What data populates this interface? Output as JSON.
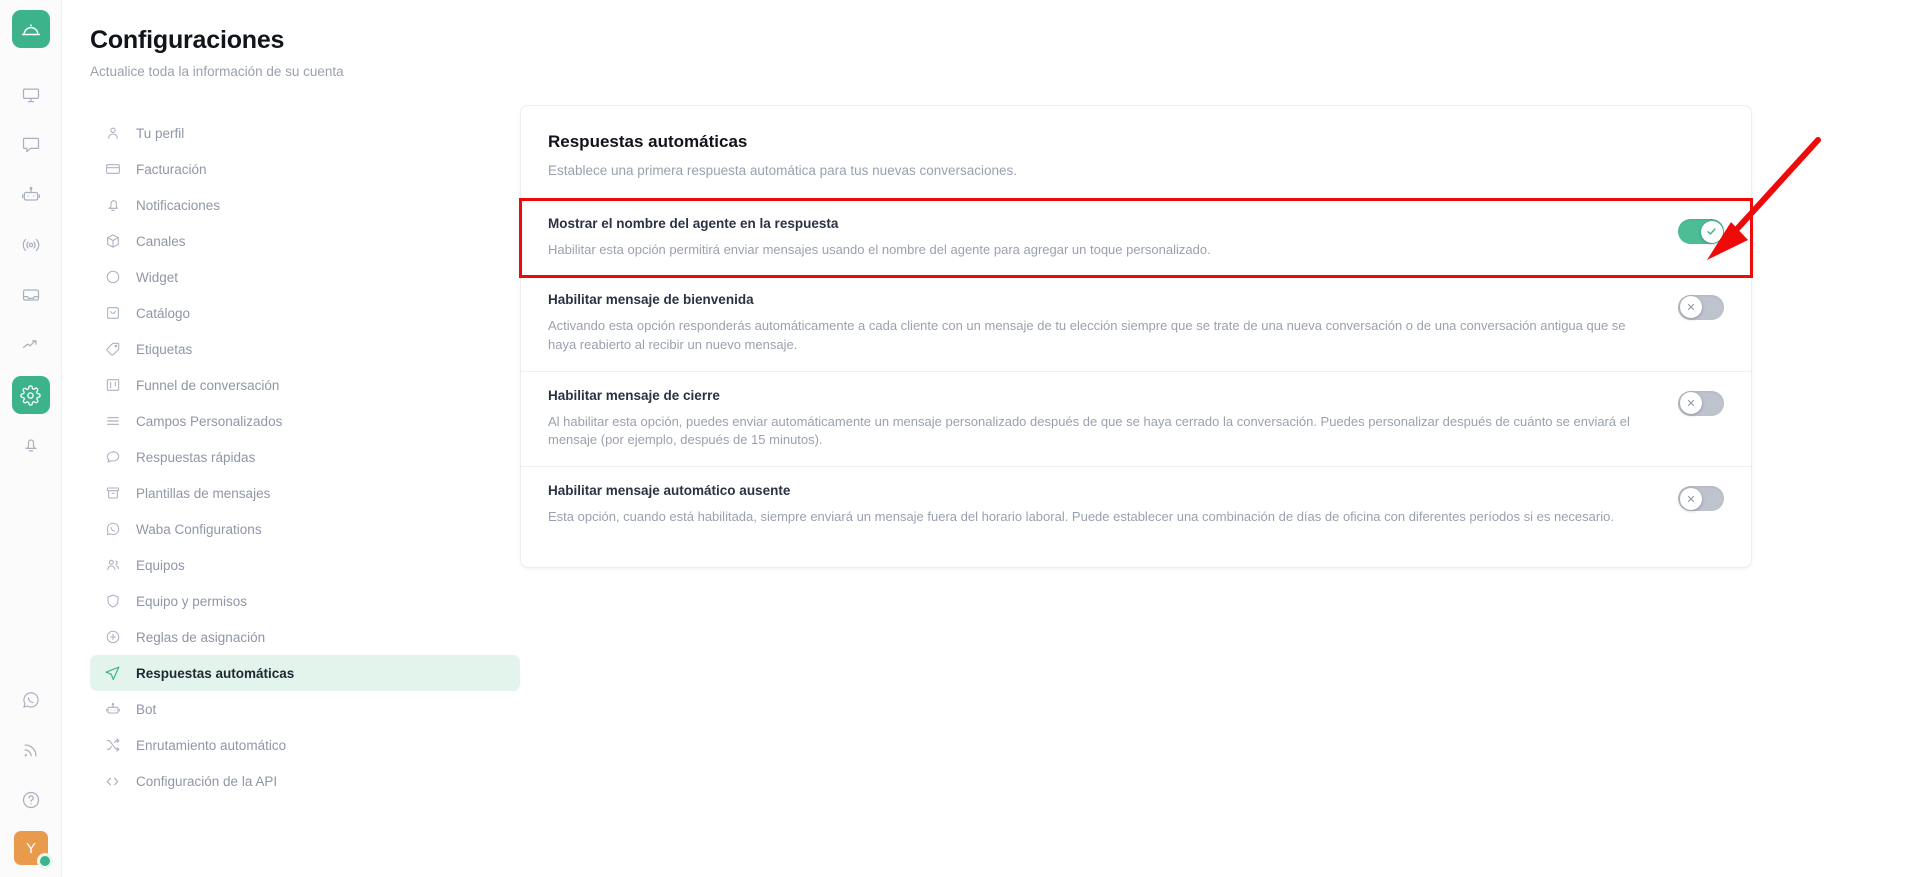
{
  "rail": {
    "logo_icon": "service-bell-icon",
    "items": [
      {
        "icon": "monitor-icon",
        "active": false
      },
      {
        "icon": "chat-bubble-icon",
        "active": false
      },
      {
        "icon": "robot-icon",
        "active": false
      },
      {
        "icon": "broadcast-icon",
        "active": false
      },
      {
        "icon": "inbox-icon",
        "active": false
      },
      {
        "icon": "trending-up-icon",
        "active": false
      },
      {
        "icon": "gear-icon",
        "active": true
      },
      {
        "icon": "bell-icon",
        "active": false
      }
    ],
    "bottom_items": [
      {
        "icon": "whatsapp-icon"
      },
      {
        "icon": "rss-icon"
      },
      {
        "icon": "help-circle-icon"
      }
    ],
    "avatar": {
      "initial": "Y",
      "status": "online"
    }
  },
  "header": {
    "title": "Configuraciones",
    "subtitle": "Actualice toda la información de su cuenta"
  },
  "settings_nav": {
    "items": [
      {
        "label": "Tu perfil",
        "icon": "user-icon",
        "active": false
      },
      {
        "label": "Facturación",
        "icon": "credit-card-icon",
        "active": false
      },
      {
        "label": "Notificaciones",
        "icon": "bell-icon",
        "active": false
      },
      {
        "label": "Canales",
        "icon": "box-icon",
        "active": false
      },
      {
        "label": "Widget",
        "icon": "circle-icon",
        "active": false
      },
      {
        "label": "Catálogo",
        "icon": "bag-icon",
        "active": false
      },
      {
        "label": "Etiquetas",
        "icon": "tag-icon",
        "active": false
      },
      {
        "label": "Funnel de conversación",
        "icon": "kanban-icon",
        "active": false
      },
      {
        "label": "Campos Personalizados",
        "icon": "list-icon",
        "active": false
      },
      {
        "label": "Respuestas rápidas",
        "icon": "message-icon",
        "active": false
      },
      {
        "label": "Plantillas de mensajes",
        "icon": "archive-icon",
        "active": false
      },
      {
        "label": "Waba Configurations",
        "icon": "whatsapp-icon",
        "active": false
      },
      {
        "label": "Equipos",
        "icon": "users-icon",
        "active": false
      },
      {
        "label": "Equipo y permisos",
        "icon": "shield-icon",
        "active": false
      },
      {
        "label": "Reglas de asignación",
        "icon": "plus-circle-icon",
        "active": false
      },
      {
        "label": "Respuestas automáticas",
        "icon": "send-icon",
        "active": true
      },
      {
        "label": "Bot",
        "icon": "robot-icon",
        "active": false
      },
      {
        "label": "Enrutamiento automático",
        "icon": "shuffle-icon",
        "active": false
      },
      {
        "label": "Configuración de la API",
        "icon": "code-icon",
        "active": false
      }
    ]
  },
  "card": {
    "title": "Respuestas automáticas",
    "subtitle": "Establece una primera respuesta automática para tus nuevas conversaciones.",
    "options": [
      {
        "title": "Mostrar el nombre del agente en la respuesta",
        "description": "Habilitar esta opción permitirá enviar mensajes usando el nombre del agente para agregar un toque personalizado.",
        "enabled": true,
        "highlighted": true,
        "toggle_icon": "check-icon"
      },
      {
        "title": "Habilitar mensaje de bienvenida",
        "description": "Activando esta opción responderás automáticamente a cada cliente con un mensaje de tu elección siempre que se trate de una nueva conversación o de una conversación antigua que se haya reabierto al recibir un nuevo mensaje.",
        "enabled": false,
        "highlighted": false,
        "toggle_icon": "close-icon"
      },
      {
        "title": "Habilitar mensaje de cierre",
        "description": "Al habilitar esta opción, puedes enviar automáticamente un mensaje personalizado después de que se haya cerrado la conversación. Puedes personalizar después de cuánto se enviará el mensaje (por ejemplo, después de 15 minutos).",
        "enabled": false,
        "highlighted": false,
        "toggle_icon": "close-icon"
      },
      {
        "title": "Habilitar mensaje automático ausente",
        "description": "Esta opción, cuando está habilitada, siempre enviará un mensaje fuera del horario laboral. Puede establecer una combinación de días de oficina con diferentes períodos si es necesario.",
        "enabled": false,
        "highlighted": false,
        "toggle_icon": "close-icon"
      }
    ]
  },
  "annotation": {
    "arrow_color": "#ef0a0a",
    "highlight_color": "#ef0a0a"
  }
}
